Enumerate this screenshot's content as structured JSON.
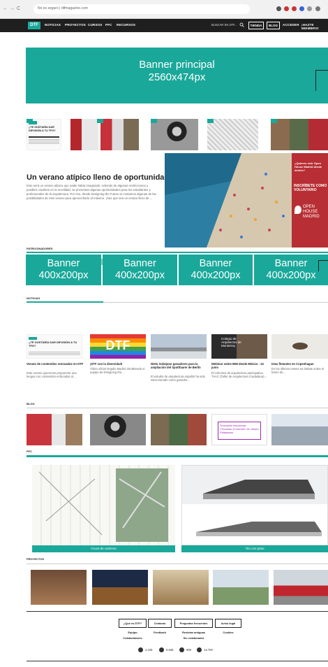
{
  "browser": {
    "url_text": "No es seguro | dtfmagazine.com",
    "back": "←",
    "forward": "→",
    "reload": "C"
  },
  "nav": {
    "logo": "DTF",
    "items": [
      "NOTICIAS",
      "PROYECTOS",
      "CURSOS",
      "PFC",
      "RECURSOS"
    ],
    "search": "BUSCAR EN DTF...",
    "search_icon": "magnifier-icon",
    "buttons": [
      "TIENDA",
      "BLOG",
      "ACCEDER"
    ],
    "member": "¡HAZTE MIEMBRO!"
  },
  "banner_main": {
    "line1": "Banner principal",
    "line2": "2560x474px"
  },
  "featured": {
    "title": "Un verano atípico lleno de oportunidades",
    "text": "Este será un verano atípico que nadie había imaginado. Además de algunas restricciones y posibles cambios en la movilidad, se presentan algunas oportunidades para los estudiantes y profesionales de la arquitectura. Por eso, desde Designing the Future te contamos algunas de las posibilidades de este verano para aprovecharlo al máximo. ¡Haz que sea un verano lleno de ...",
    "readmore": "SEGUIR LEYENDO »",
    "thumb_caption": "¿TE GUSTARÍA DAR DIFUSIÓN A TU TFG?",
    "ad_q": "¿Quieres vivir Open House Madrid desde dentro?",
    "ad_cta": "INSCRÍBETE COMO VOLUNTARIO",
    "ad_brand": "OPEN HOUSE MADRID"
  },
  "sponsors": {
    "label": "PATROCINADORES",
    "banners": [
      {
        "l1": "Banner",
        "l2": "400x200px"
      },
      {
        "l1": "Banner",
        "l2": "400x200px"
      },
      {
        "l1": "Banner",
        "l2": "400x200px"
      },
      {
        "l1": "Banner",
        "l2": "400x200px"
      }
    ]
  },
  "news": {
    "label": "NOTICIAS",
    "items": [
      {
        "title": "Verano de contenidos renovados en DTF",
        "text": "Este verano queremos proponerte una lengua con contenidos enfocados al..."
      },
      {
        "title": "¡DTF con la diversidad!",
        "text": "Vídeo oficial Orgullo Madrid 2019Desde el equipo de Designing the..."
      },
      {
        "title": "Nieto Sobejano ganadores para la ampliación del Spottfaarer de Berlín",
        "text": "El estudio de arquitectura español ha sido seleccionado como ganador..."
      },
      {
        "title": "Webinar sobre BIM desde México - 24 junio",
        "text": "El colectivo de arquitectura participativa TAAC (Taller de Arquitectura Ciudadana)..."
      },
      {
        "title": "Islas flotantes en Copenhague",
        "text": "En los últimos meses se debate sobre el futuro de..."
      }
    ],
    "thumb_caption": "¿TE GUSTARÍA DAR DIFUSIÓN A TU TFG?",
    "rainbow_text": "DTF",
    "mexico_text": "Colegio de Arquitectos de Monterrey"
  },
  "blog": {
    "label": "BLOG",
    "quote": "Trencadís emocional: «Tocando el mundo» de Juhani Pallasmaa"
  },
  "pfc": {
    "label": "PFC",
    "captions": [
      "Cruce de caminos",
      "Tiro con plato"
    ]
  },
  "projects": {
    "label": "PROYECTOS"
  },
  "footer": {
    "buttons": [
      "¿Qué es DTF?",
      "Contacto",
      "Preguntas frecuentes",
      "Aviso legal"
    ],
    "links": [
      "Equipo",
      "Feedback",
      "Revistas antiguas",
      "Cookies",
      "Colaboradores",
      "Ser colaborador"
    ],
    "social": [
      {
        "icon": "instagram-icon",
        "count": "2.226"
      },
      {
        "icon": "facebook-icon",
        "count": "5.636"
      },
      {
        "icon": "twitter-icon",
        "count": "909"
      },
      {
        "icon": "pinterest-icon",
        "count": "13.700"
      }
    ]
  },
  "colors": {
    "accent": "#1aa89a",
    "nav": "#1f1f1f"
  }
}
